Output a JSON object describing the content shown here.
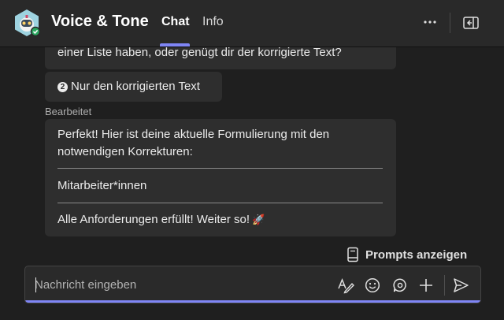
{
  "header": {
    "app_name": "Voice & Tone",
    "tabs": [
      {
        "label": "Chat",
        "active": true
      },
      {
        "label": "Info",
        "active": false
      }
    ],
    "accent_color": "#7f85f5",
    "more_icon": "more-horizontal-icon",
    "panel_icon": "open-panel-icon"
  },
  "chat": {
    "truncated_message": "einer Liste haben, oder genügt dir der korrigierte Text?",
    "option": {
      "number": "2",
      "label": "Nur den korrigierten Text"
    },
    "edited_label": "Bearbeitet",
    "reply": {
      "line1": "Perfekt! Hier ist deine aktuelle Formulierung mit den",
      "line2": "notwendigen Korrekturen:",
      "correction": "Mitarbeiter*innen",
      "footer": "Alle Anforderungen erfüllt! Weiter so!",
      "footer_emoji": "🚀"
    }
  },
  "prompts": {
    "label": "Prompts anzeigen",
    "icon": "prompt-book-icon"
  },
  "composer": {
    "placeholder": "Nachricht eingeben",
    "value": "",
    "icons": [
      "format-icon",
      "emoji-icon",
      "loop-icon",
      "plus-icon",
      "send-icon"
    ]
  }
}
